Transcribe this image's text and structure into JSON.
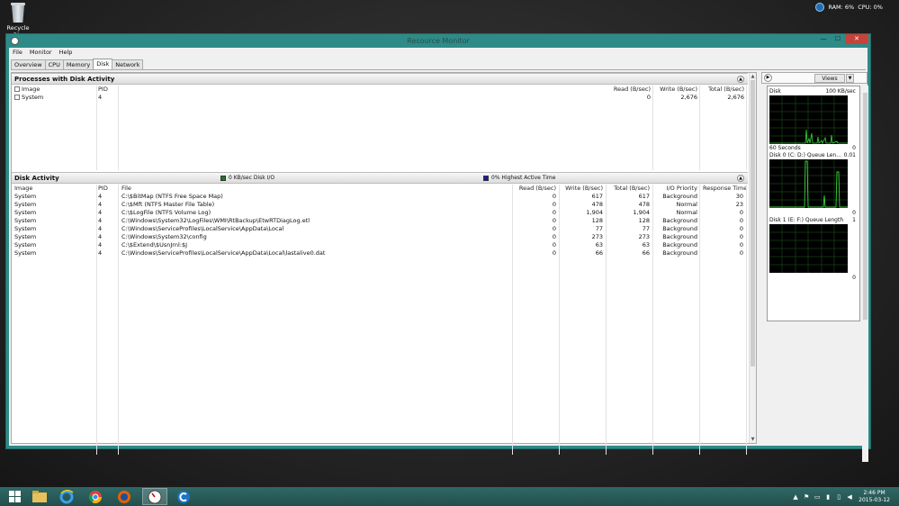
{
  "desktop": {
    "recycle_bin_label": "Recycle Bin",
    "top_tray": {
      "ram": "RAM: 6%",
      "cpu": "CPU: 0%"
    }
  },
  "window": {
    "title": "Resource Monitor",
    "buttons": {
      "minimize": "—",
      "maximize": "☐",
      "close": "✕"
    }
  },
  "menu": [
    "File",
    "Monitor",
    "Help"
  ],
  "tabs": [
    "Overview",
    "CPU",
    "Memory",
    "Disk",
    "Network"
  ],
  "active_tab": "Disk",
  "processes": {
    "title": "Processes with Disk Activity",
    "columns": [
      "Image",
      "PID",
      "Read (B/sec)",
      "Write (B/sec)",
      "Total (B/sec)"
    ],
    "rows": [
      {
        "image": "System",
        "pid": "4",
        "read": "0",
        "write": "2,676",
        "total": "2,676"
      }
    ]
  },
  "disk_activity": {
    "title": "Disk Activity",
    "legend_io": "0 KB/sec Disk I/O",
    "legend_active": "0% Highest Active Time",
    "legend_io_color": "#1a7a1a",
    "legend_active_color": "#1a1aa8",
    "columns": [
      "Image",
      "PID",
      "File",
      "Read (B/sec)",
      "Write (B/sec)",
      "Total (B/sec)",
      "I/O Priority",
      "Response Time ..."
    ],
    "rows": [
      {
        "image": "System",
        "pid": "4",
        "file": "C:\\$BitMap (NTFS Free Space Map)",
        "read": "0",
        "write": "617",
        "total": "617",
        "priority": "Background",
        "response": "30"
      },
      {
        "image": "System",
        "pid": "4",
        "file": "C:\\$Mft (NTFS Master File Table)",
        "read": "0",
        "write": "478",
        "total": "478",
        "priority": "Normal",
        "response": "23"
      },
      {
        "image": "System",
        "pid": "4",
        "file": "C:\\$LogFile (NTFS Volume Log)",
        "read": "0",
        "write": "1,904",
        "total": "1,904",
        "priority": "Normal",
        "response": "0"
      },
      {
        "image": "System",
        "pid": "4",
        "file": "C:\\Windows\\System32\\LogFiles\\WMI\\RtBackup\\EtwRTDiagLog.etl",
        "read": "0",
        "write": "128",
        "total": "128",
        "priority": "Background",
        "response": "0"
      },
      {
        "image": "System",
        "pid": "4",
        "file": "C:\\Windows\\ServiceProfiles\\LocalService\\AppData\\Local",
        "read": "0",
        "write": "77",
        "total": "77",
        "priority": "Background",
        "response": "0"
      },
      {
        "image": "System",
        "pid": "4",
        "file": "C:\\Windows\\System32\\config",
        "read": "0",
        "write": "273",
        "total": "273",
        "priority": "Background",
        "response": "0"
      },
      {
        "image": "System",
        "pid": "4",
        "file": "C:\\$Extend\\$UsnJrnl:$J",
        "read": "0",
        "write": "63",
        "total": "63",
        "priority": "Background",
        "response": "0"
      },
      {
        "image": "System",
        "pid": "4",
        "file": "C:\\Windows\\ServiceProfiles\\LocalService\\AppData\\Local\\lastalive0.dat",
        "read": "0",
        "write": "66",
        "total": "66",
        "priority": "Background",
        "response": "0"
      }
    ]
  },
  "graphs": {
    "views_label": "Views",
    "disk": {
      "title": "Disk",
      "max": "100 KB/sec",
      "time": "60 Seconds",
      "min": "0"
    },
    "disk0": {
      "title": "Disk 0 (C: D:) Queue Len...",
      "max": "0.01",
      "min": "0"
    },
    "disk1": {
      "title": "Disk 1 (E: F:) Queue Length",
      "max": "1",
      "min": "0"
    }
  },
  "taskbar": {
    "time": "2:46 PM",
    "date": "2015-03-12",
    "apps": [
      "start",
      "file-explorer",
      "internet-explorer",
      "chrome",
      "firefox",
      "resource-monitor",
      "ccleaner"
    ]
  }
}
